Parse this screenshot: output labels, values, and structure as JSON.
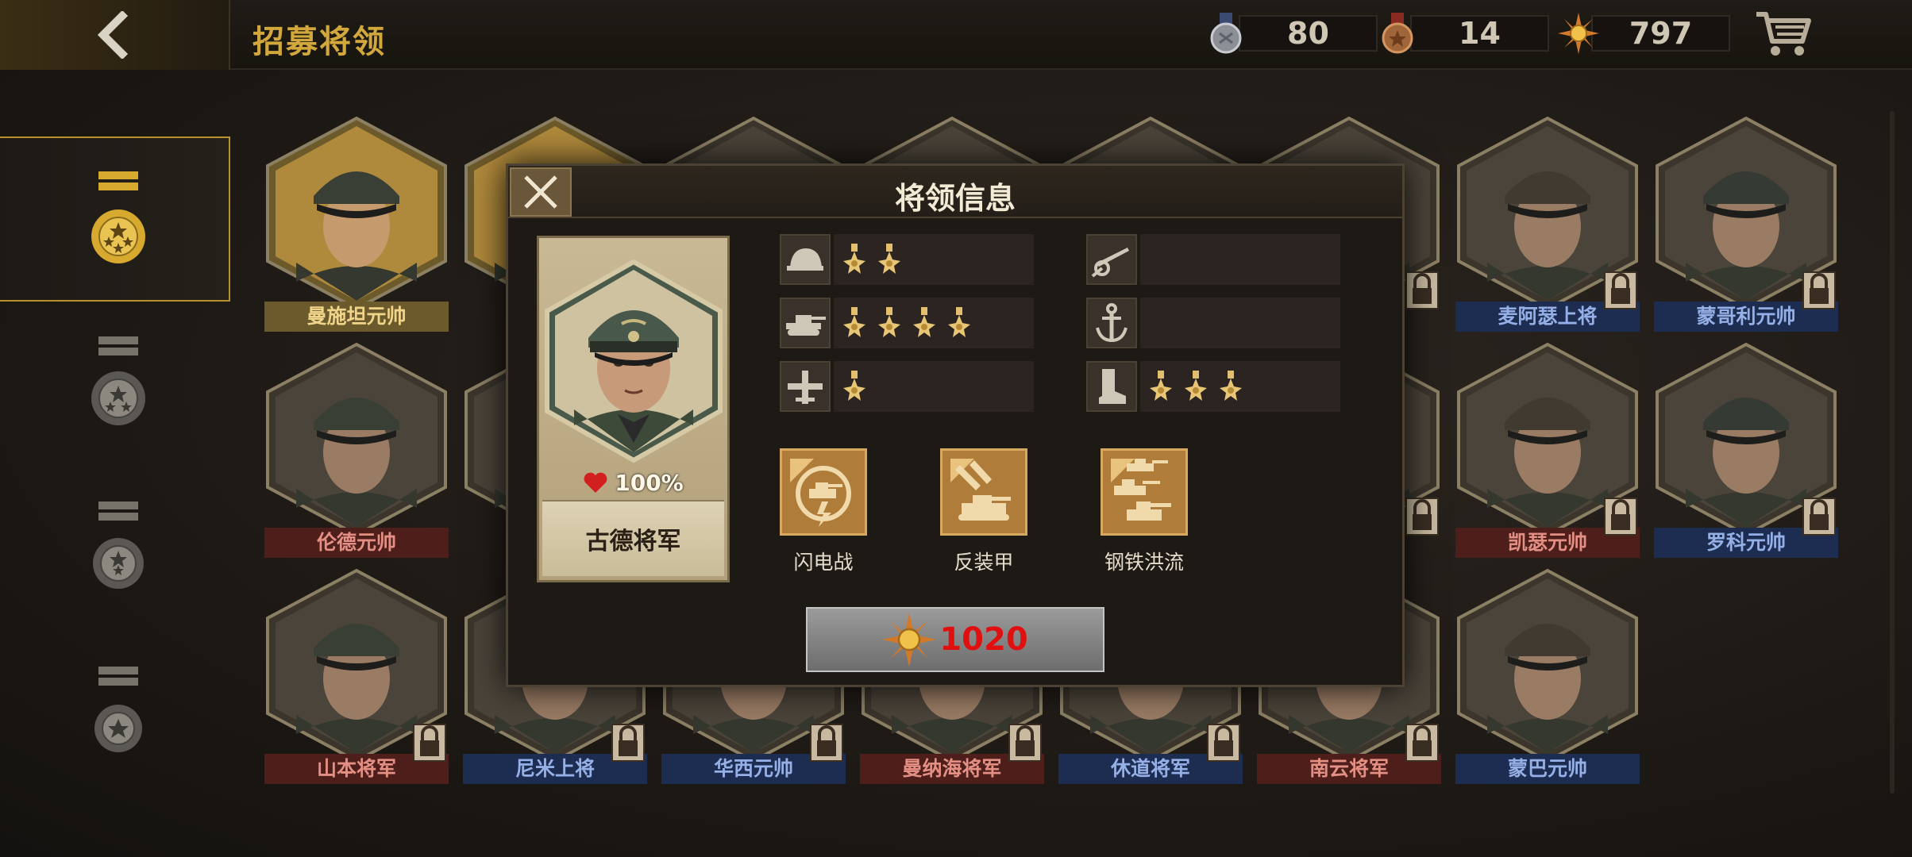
{
  "header": {
    "title": "招募将领",
    "resources": [
      {
        "icon": "silver-medal-icon",
        "value": "80"
      },
      {
        "icon": "bronze-medal-icon",
        "value": "14"
      },
      {
        "icon": "gold-sun-medal-icon",
        "value": "797"
      }
    ]
  },
  "tabs": [
    {
      "name": "tier-4-stars-tab",
      "active": true
    },
    {
      "name": "tier-3-stars-tab",
      "active": false
    },
    {
      "name": "tier-2-stars-tab",
      "active": false
    },
    {
      "name": "tier-1-star-tab",
      "active": false
    }
  ],
  "generals": [
    {
      "name": "曼施坦元帅",
      "color": "gold",
      "locked": false
    },
    {
      "name": "",
      "color": "gold",
      "locked": false
    },
    {
      "name": "",
      "color": "red",
      "locked": false
    },
    {
      "name": "",
      "color": "red",
      "locked": false
    },
    {
      "name": "",
      "color": "blue",
      "locked": false
    },
    {
      "name": "",
      "color": "blue",
      "locked": true
    },
    {
      "name": "麦阿瑟上将",
      "color": "blue",
      "locked": true
    },
    {
      "name": "蒙哥利元帅",
      "color": "blue",
      "locked": true
    },
    {
      "name": "伦德元帅",
      "color": "red",
      "locked": false
    },
    {
      "name": "",
      "color": "blue",
      "locked": false
    },
    {
      "name": "",
      "color": "red",
      "locked": false
    },
    {
      "name": "",
      "color": "red",
      "locked": false
    },
    {
      "name": "",
      "color": "blue",
      "locked": false
    },
    {
      "name": "",
      "color": "blue",
      "locked": true
    },
    {
      "name": "凯瑟元帅",
      "color": "red",
      "locked": true
    },
    {
      "name": "罗科元帅",
      "color": "blue",
      "locked": true
    },
    {
      "name": "山本将军",
      "color": "red",
      "locked": true
    },
    {
      "name": "尼米上将",
      "color": "blue",
      "locked": true
    },
    {
      "name": "华西元帅",
      "color": "blue",
      "locked": true
    },
    {
      "name": "曼纳海将军",
      "color": "red",
      "locked": true
    },
    {
      "name": "休道将军",
      "color": "blue",
      "locked": true
    },
    {
      "name": "南云将军",
      "color": "red",
      "locked": true
    },
    {
      "name": "蒙巴元帅",
      "color": "blue",
      "locked": false
    }
  ],
  "modal": {
    "title": "将领信息",
    "general_name": "古德将军",
    "loyalty": "100%",
    "stats": [
      {
        "icon": "infantry-helmet-icon",
        "medals": 2
      },
      {
        "icon": "tank-icon",
        "medals": 4
      },
      {
        "icon": "airplane-icon",
        "medals": 1
      },
      {
        "icon": "artillery-cannon-icon",
        "medals": 0
      },
      {
        "icon": "navy-anchor-icon",
        "medals": 0
      },
      {
        "icon": "boot-march-icon",
        "medals": 3
      }
    ],
    "skills": [
      {
        "name": "闪电战",
        "icon": "blitz-tank-icon"
      },
      {
        "name": "反装甲",
        "icon": "anti-armor-icon"
      },
      {
        "name": "钢铁洪流",
        "icon": "steel-torrent-icon"
      }
    ],
    "price": "1020"
  }
}
